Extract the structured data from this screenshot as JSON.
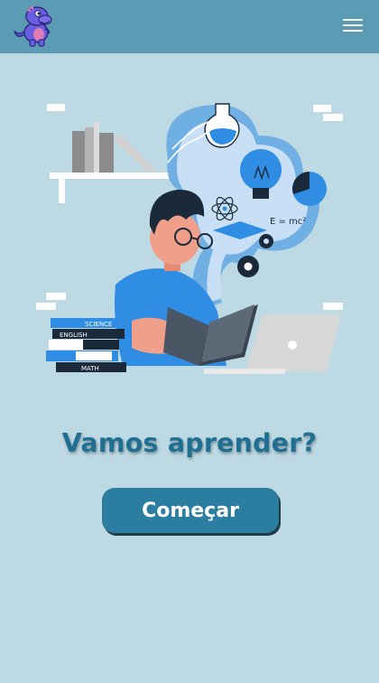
{
  "header": {
    "logo_icon": "dinosaur-icon",
    "menu_icon": "hamburger-menu-icon"
  },
  "hero": {
    "illustration_icon": "student-reading-illustration",
    "book_labels": [
      "SCIENCE",
      "ENGLISH",
      "MATH"
    ],
    "formula_text": "E = mc²"
  },
  "main": {
    "headline": "Vamos aprender?",
    "start_button_label": "Começar"
  },
  "colors": {
    "background": "#bdd9e4",
    "header": "#5b9bb3",
    "headline": "#1f6f93",
    "button": "#2b7e9f",
    "button_text": "#ffffff"
  }
}
